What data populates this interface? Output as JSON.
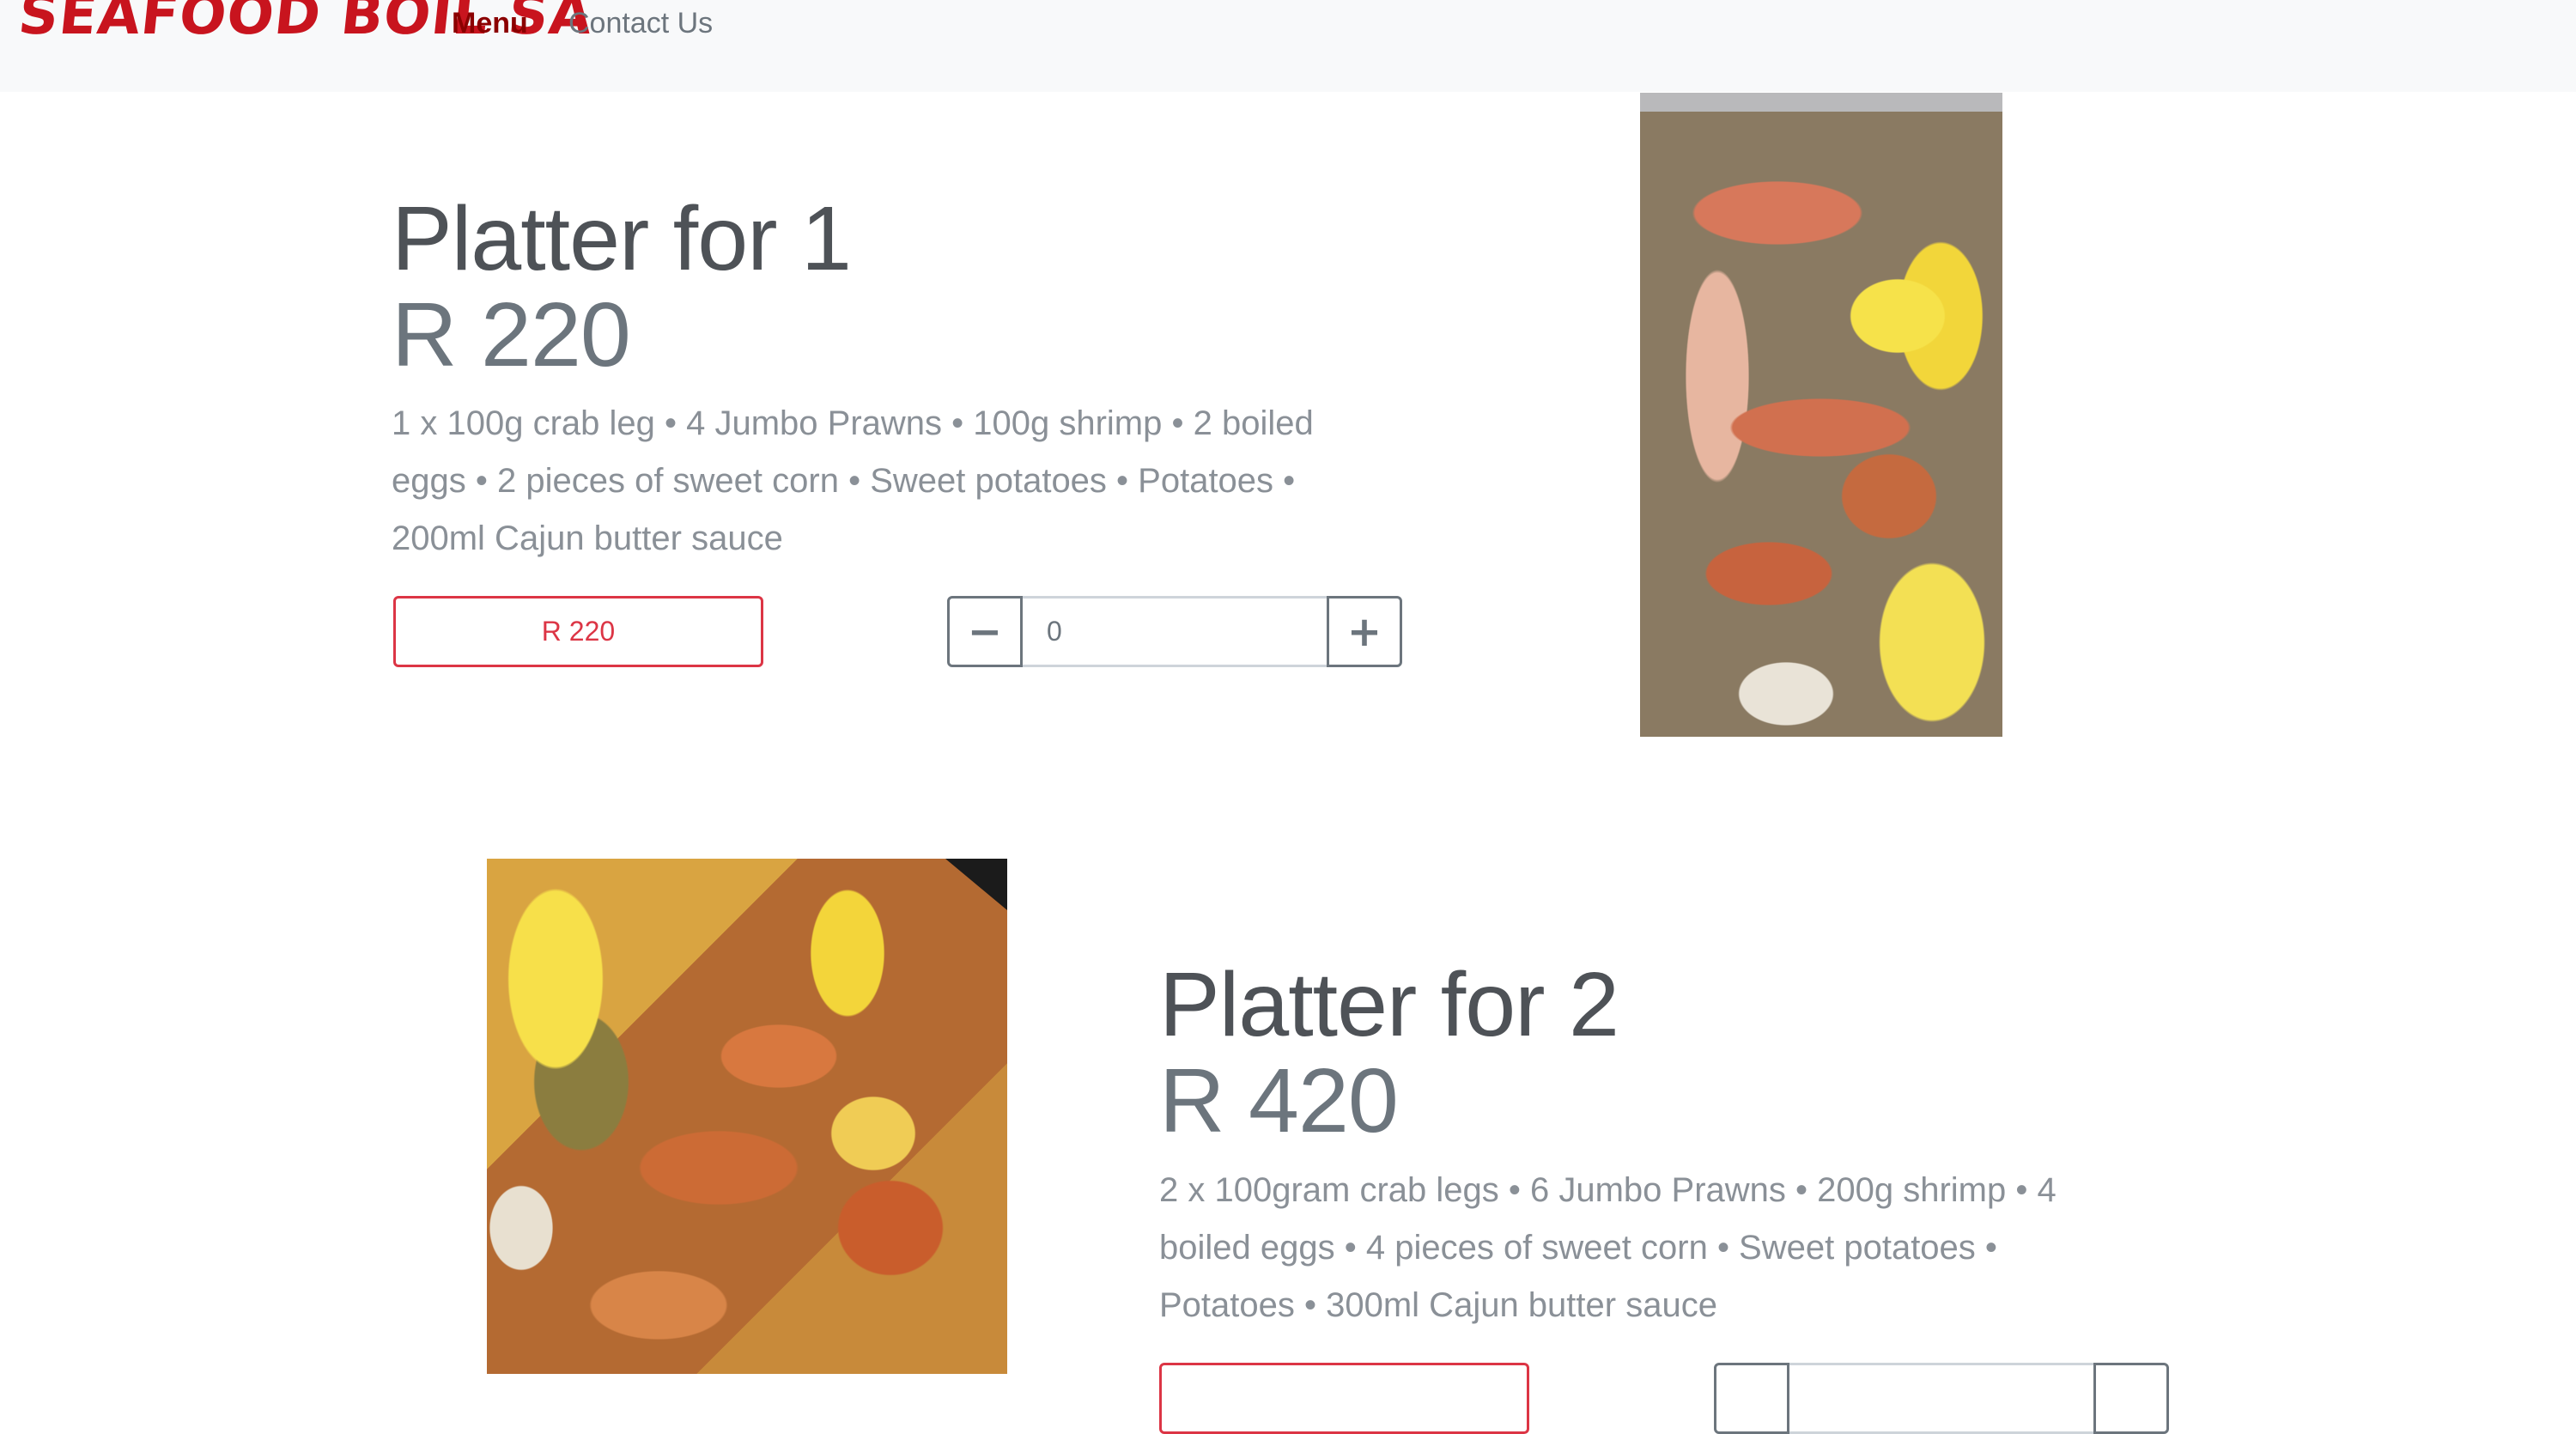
{
  "navbar": {
    "brand": "SEAFOOD BOIL SA",
    "links": [
      {
        "label": "Menu"
      },
      {
        "label": "Contact Us"
      }
    ]
  },
  "platters": [
    {
      "title": "Platter for 1",
      "price": "R 220",
      "desc_lines": [
        "1 x 100g crab leg • 4 Jumbo Prawns • 100g shrimp • 2 boiled",
        "eggs • 2 pieces of sweet corn • Sweet potatoes • Potatoes •",
        "200ml Cajun butter sauce"
      ],
      "button_label": "R 220",
      "quantity": "0",
      "minus_icon": "minus-icon",
      "plus_icon": "plus-icon"
    },
    {
      "title": "Platter for 2",
      "price": "R 420",
      "desc_lines": [
        "2 x 100gram crab legs • 6 Jumbo Prawns • 200g shrimp • 4",
        "boiled eggs • 4 pieces of sweet corn • Sweet potatoes •",
        "Potatoes • 300ml Cajun butter sauce"
      ]
    }
  ],
  "colors": {
    "brand": "#c8141e",
    "menu_active": "#8b0000",
    "button_outline": "#dc3545",
    "navbar_bg": "#f8f9fa"
  }
}
